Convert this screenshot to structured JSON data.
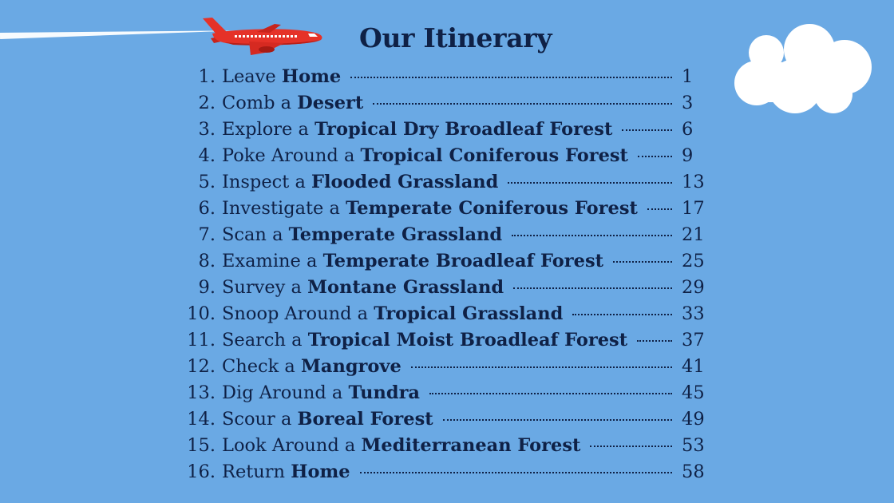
{
  "title": "Our Itinerary",
  "colors": {
    "background": "#6aa9e4",
    "text": "#0f2146",
    "plane": "#e53228",
    "cloud": "#ffffff"
  },
  "decorations": {
    "plane": "airplane-icon",
    "cloud": "cloud-icon",
    "contrail": "contrail"
  },
  "items": [
    {
      "num": "1.",
      "action": "Leave ",
      "place": "Home",
      "page": "1"
    },
    {
      "num": "2.",
      "action": "Comb a ",
      "place": "Desert",
      "page": "3"
    },
    {
      "num": "3.",
      "action": "Explore a ",
      "place": "Tropical Dry Broadleaf Forest",
      "page": "6"
    },
    {
      "num": "4.",
      "action": "Poke Around a ",
      "place": "Tropical Coniferous Forest",
      "page": "9"
    },
    {
      "num": "5.",
      "action": "Inspect a ",
      "place": "Flooded Grassland",
      "page": "13"
    },
    {
      "num": "6.",
      "action": "Investigate a ",
      "place": "Temperate Coniferous Forest",
      "page": "17"
    },
    {
      "num": "7.",
      "action": "Scan a ",
      "place": "Temperate Grassland",
      "page": "21"
    },
    {
      "num": "8.",
      "action": "Examine a ",
      "place": "Temperate Broadleaf Forest",
      "page": "25"
    },
    {
      "num": "9.",
      "action": "Survey a ",
      "place": "Montane Grassland",
      "page": "29"
    },
    {
      "num": "10.",
      "action": "Snoop Around a ",
      "place": "Tropical Grassland",
      "page": "33"
    },
    {
      "num": "11.",
      "action": "Search a ",
      "place": "Tropical Moist Broadleaf Forest",
      "page": "37"
    },
    {
      "num": "12.",
      "action": "Check a ",
      "place": "Mangrove",
      "page": "41"
    },
    {
      "num": "13.",
      "action": "Dig Around a ",
      "place": "Tundra",
      "page": "45"
    },
    {
      "num": "14.",
      "action": "Scour a ",
      "place": "Boreal Forest",
      "page": "49"
    },
    {
      "num": "15.",
      "action": "Look Around a ",
      "place": "Mediterranean Forest",
      "page": "53"
    },
    {
      "num": "16.",
      "action": "Return ",
      "place": "Home",
      "page": "58"
    }
  ]
}
